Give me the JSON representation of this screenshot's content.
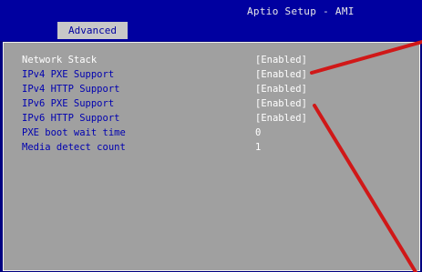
{
  "header": {
    "title": "Aptio Setup - AMI"
  },
  "tabs": [
    {
      "label": "Advanced"
    }
  ],
  "settings": [
    {
      "label": "Network Stack",
      "value": "[Enabled]"
    },
    {
      "label": "IPv4 PXE Support",
      "value": "[Enabled]"
    },
    {
      "label": "IPv4 HTTP Support",
      "value": "[Enabled]"
    },
    {
      "label": "IPv6 PXE Support",
      "value": "[Enabled]"
    },
    {
      "label": "IPv6 HTTP Support",
      "value": "[Enabled]"
    },
    {
      "label": "PXE boot wait time",
      "value": "0"
    },
    {
      "label": "Media detect count",
      "value": "1"
    }
  ],
  "colors": {
    "header_bg": "#0000a0",
    "panel_bg": "#a0a0a0",
    "label_text": "#0000b0",
    "value_text": "#ffffff",
    "annotation_arrow": "#d01818"
  }
}
